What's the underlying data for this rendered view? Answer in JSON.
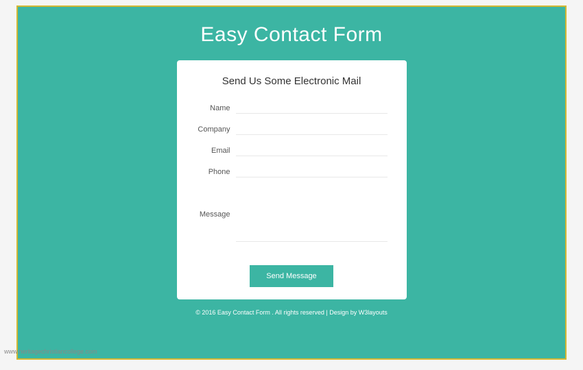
{
  "page": {
    "title": "Easy Contact Form"
  },
  "form": {
    "heading": "Send Us Some Electronic Mail",
    "fields": {
      "name": {
        "label": "Name",
        "value": ""
      },
      "company": {
        "label": "Company",
        "value": ""
      },
      "email": {
        "label": "Email",
        "value": ""
      },
      "phone": {
        "label": "Phone",
        "value": ""
      },
      "message": {
        "label": "Message",
        "value": ""
      }
    },
    "submit_label": "Send Message"
  },
  "footer": {
    "text": "© 2016 Easy Contact Form . All rights reserved | Design by W3layouts"
  },
  "watermark": "www.heritagechristiancollege.com"
}
